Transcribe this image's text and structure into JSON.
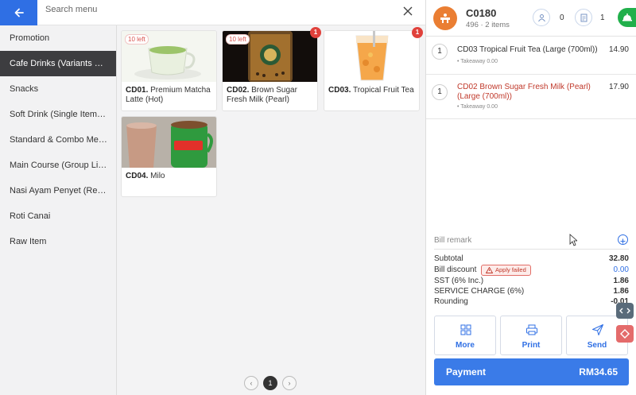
{
  "search": {
    "placeholder": "Search menu"
  },
  "colors": {
    "accent": "#2f6fe4",
    "active_category": "#3d3d40",
    "alert": "#e0413b",
    "success": "#21b04b",
    "table_avatar": "#ea7e33"
  },
  "categories": [
    {
      "label": "Promotion",
      "active": false
    },
    {
      "label": "Cafe Drinks (Variants & Gr...",
      "active": true
    },
    {
      "label": "Snacks",
      "active": false
    },
    {
      "label": "Soft Drink (Single Item Set...",
      "active": false
    },
    {
      "label": "Standard & Combo Meal (I...",
      "active": false
    },
    {
      "label": "Main Course (Group Link ...",
      "active": false
    },
    {
      "label": "Nasi Ayam Penyet (Recipe...",
      "active": false
    },
    {
      "label": "Roti Canai",
      "active": false
    },
    {
      "label": "Raw Item",
      "active": false
    }
  ],
  "products": [
    {
      "code": "CD01.",
      "name": "Premium Matcha Latte (Hot)",
      "stock": "10 left",
      "badge": ""
    },
    {
      "code": "CD02.",
      "name": "Brown Sugar Fresh Milk (Pearl)",
      "stock": "10 left",
      "badge": "1"
    },
    {
      "code": "CD03.",
      "name": "Tropical Fruit Tea",
      "stock": "",
      "badge": "1"
    },
    {
      "code": "CD04.",
      "name": "Milo",
      "stock": "",
      "badge": ""
    }
  ],
  "pagination": {
    "prev": "‹",
    "current": "1",
    "next": "›"
  },
  "order": {
    "table": "C0180",
    "subtitle": "496 · 2 items",
    "guests": "0",
    "bills": "1",
    "items": [
      {
        "qty": "1",
        "name": "CD03 Tropical Fruit Tea (Large (700ml))",
        "sub": "• Takeaway 0.00",
        "price": "14.90",
        "highlight": false
      },
      {
        "qty": "1",
        "name": "CD02 Brown Sugar Fresh Milk (Pearl) (Large (700ml))",
        "sub": "• Takeaway 0.00",
        "price": "17.90",
        "highlight": true
      }
    ],
    "remark_label": "Bill remark",
    "summary": {
      "subtotal_label": "Subtotal",
      "subtotal": "32.80",
      "discount_label": "Bill discount",
      "discount_status": "Apply failed",
      "discount": "0.00",
      "sst_label": "SST (6% Inc.)",
      "sst": "1.86",
      "service_label": "SERVICE CHARGE (6%)",
      "service": "1.86",
      "rounding_label": "Rounding",
      "rounding": "-0.01"
    },
    "actions": {
      "more": "More",
      "print": "Print",
      "send": "Send"
    },
    "payment": {
      "label": "Payment",
      "amount": "RM34.65"
    }
  }
}
